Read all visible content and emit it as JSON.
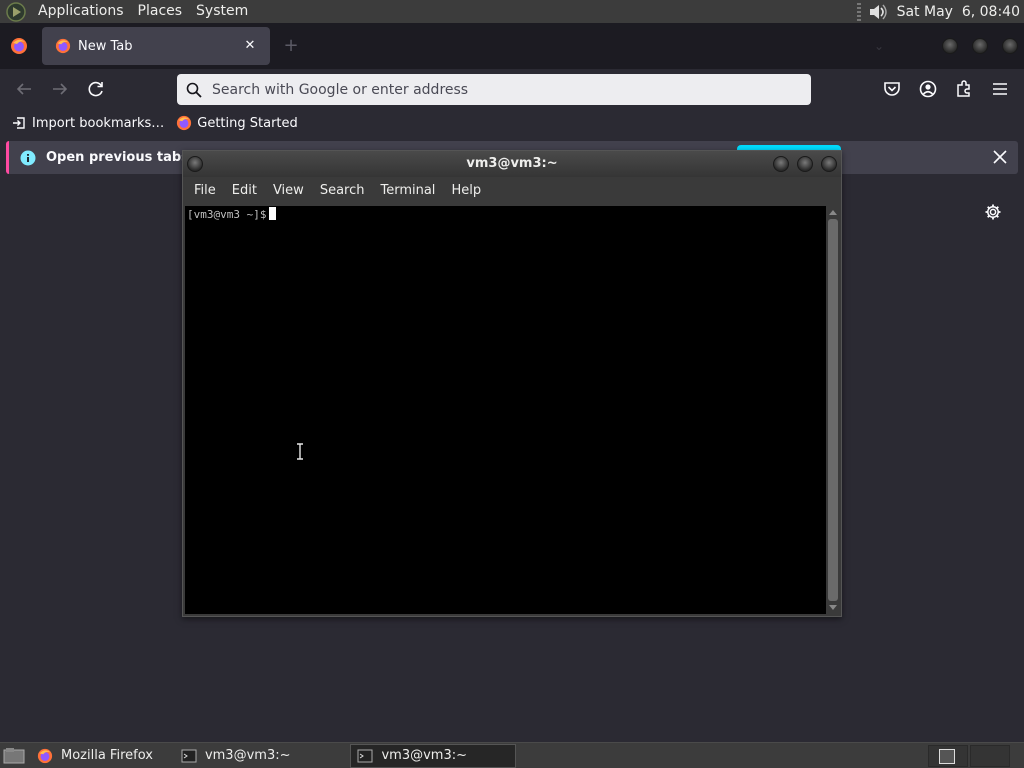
{
  "top_panel": {
    "menus": [
      "Applications",
      "Places",
      "System"
    ],
    "clock": "Sat May  6, 08:40"
  },
  "firefox": {
    "tab": {
      "title": "New Tab"
    },
    "urlbar": {
      "placeholder": "Search with Google or enter address"
    },
    "bookmarks": [
      "Import bookmarks…",
      "Getting Started"
    ],
    "notification": {
      "message": "Open previous tabs? \\"
    }
  },
  "terminal": {
    "title": "vm3@vm3:~",
    "menus": [
      "File",
      "Edit",
      "View",
      "Search",
      "Terminal",
      "Help"
    ],
    "prompt": "[vm3@vm3 ~]$"
  },
  "taskbar": {
    "tasks": [
      "Mozilla Firefox",
      "vm3@vm3:~",
      "vm3@vm3:~"
    ]
  },
  "colors": {
    "firefox_toolbar": "#2b2a33",
    "tab_active": "#42414d",
    "notification_accent": "#00ddff",
    "terminal_bg": "#000000"
  }
}
